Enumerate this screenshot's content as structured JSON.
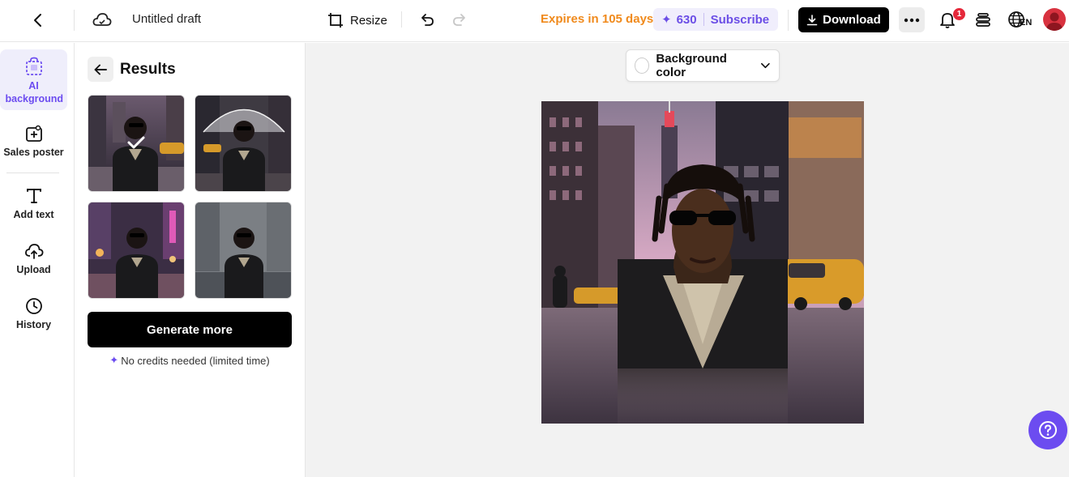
{
  "header": {
    "title": "Untitled draft",
    "resize_label": "Resize",
    "expires_text": "Expires in 105 days",
    "credits": "630",
    "subscribe_label": "Subscribe",
    "download_label": "Download",
    "notification_count": "1",
    "language": "EN"
  },
  "colors": {
    "accent": "#6c4cf0",
    "expires": "#f08a1c",
    "badge": "#e5283a"
  },
  "sidebar": {
    "items": [
      {
        "label": "AI background",
        "icon": "ai-background-icon",
        "active": true
      },
      {
        "label": "Sales poster",
        "icon": "sales-poster-icon"
      },
      {
        "label": "Add text",
        "icon": "text-icon"
      },
      {
        "label": "Upload",
        "icon": "upload-cloud-icon"
      },
      {
        "label": "History",
        "icon": "history-clock-icon"
      }
    ]
  },
  "results": {
    "title": "Results",
    "thumbnails": [
      {
        "name": "city street rain",
        "selected": true
      },
      {
        "name": "umbrella street",
        "selected": false
      },
      {
        "name": "neon lights street",
        "selected": false
      },
      {
        "name": "grey city puddle",
        "selected": false
      }
    ],
    "generate_label": "Generate more",
    "note": "No credits needed (limited time)"
  },
  "canvas": {
    "background_color_label": "Background color"
  }
}
